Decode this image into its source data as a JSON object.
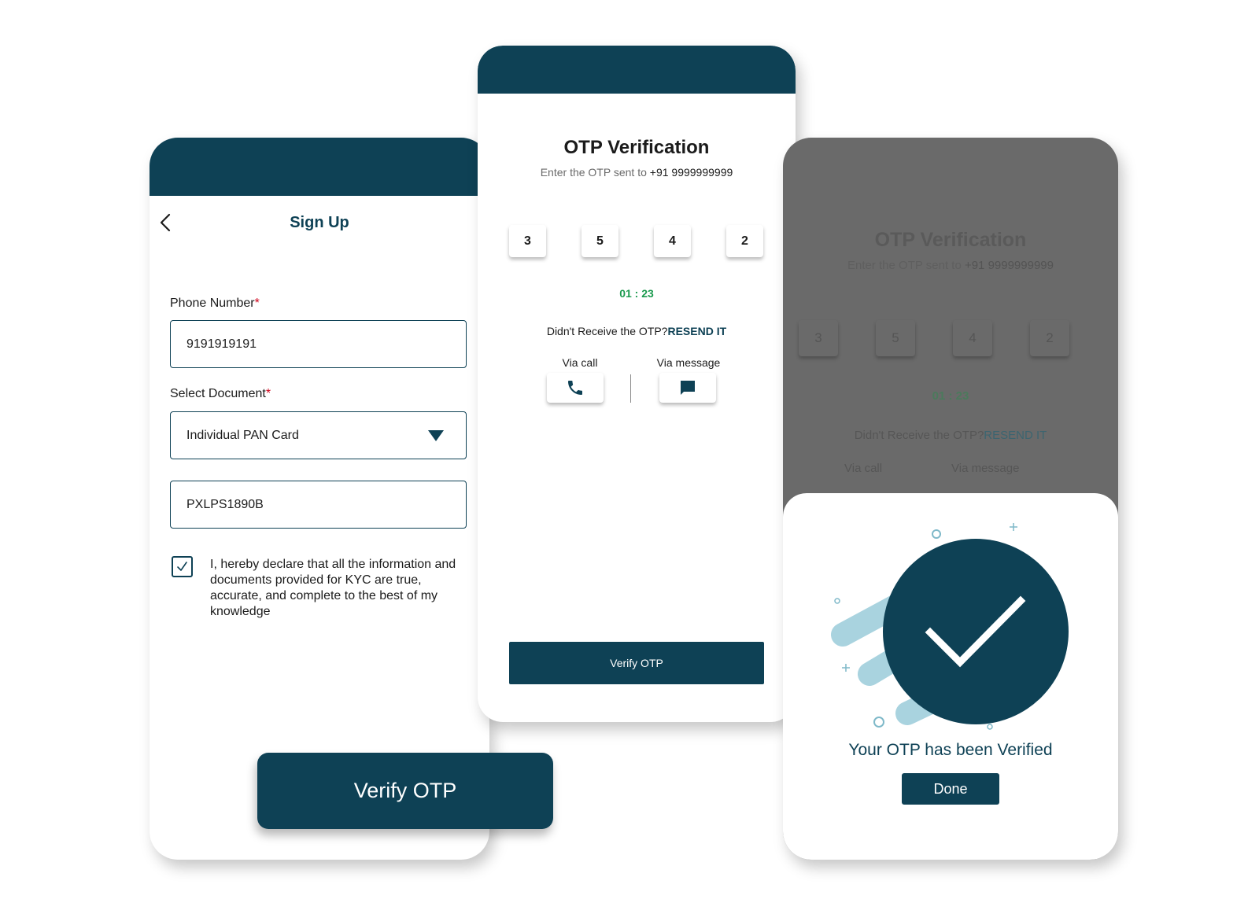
{
  "signup": {
    "title": "Sign Up",
    "phone_label": "Phone Number",
    "required_mark": "*",
    "phone_value": "9191919191",
    "document_label": "Select Document",
    "document_value": "Individual PAN Card",
    "pan_value": "PXLPS1890B",
    "declaration": "I, hereby declare that all the information and documents provided for KYC are true, accurate, and complete to the best of my knowledge",
    "checkbox_checked": true
  },
  "verify_big_label": "Verify OTP",
  "otp": {
    "title": "OTP Verification",
    "subtitle_prefix": "Enter the OTP sent to ",
    "phone": "+91 9999999999",
    "digits": [
      "3",
      "5",
      "4",
      "2"
    ],
    "timer": "01 : 23",
    "resend_prompt": "Didn't Receive the OTP?",
    "resend_link": "RESEND IT",
    "via_call": "Via call",
    "via_message": "Via message",
    "verify_label": "Verify OTP"
  },
  "verified": {
    "dim_title": "OTP Verification",
    "dim_subtitle_prefix": "Enter the OTP sent to ",
    "dim_phone": "+91 9999999999",
    "dim_digits": [
      "3",
      "5",
      "4",
      "2"
    ],
    "dim_timer": "01 : 23",
    "dim_resend_prompt": "Didn't Receive the OTP?",
    "dim_resend_link": "RESEND IT",
    "dim_via_call": "Via call",
    "dim_via_message": "Via message",
    "message": "Your OTP has been Verified",
    "done_label": "Done"
  },
  "colors": {
    "primary": "#0e4155",
    "timer_green": "#1b9a4e",
    "required_red": "#d0021b",
    "overlay_gray": "#6a6a6a",
    "accent_light_blue": "#a9d3df"
  }
}
